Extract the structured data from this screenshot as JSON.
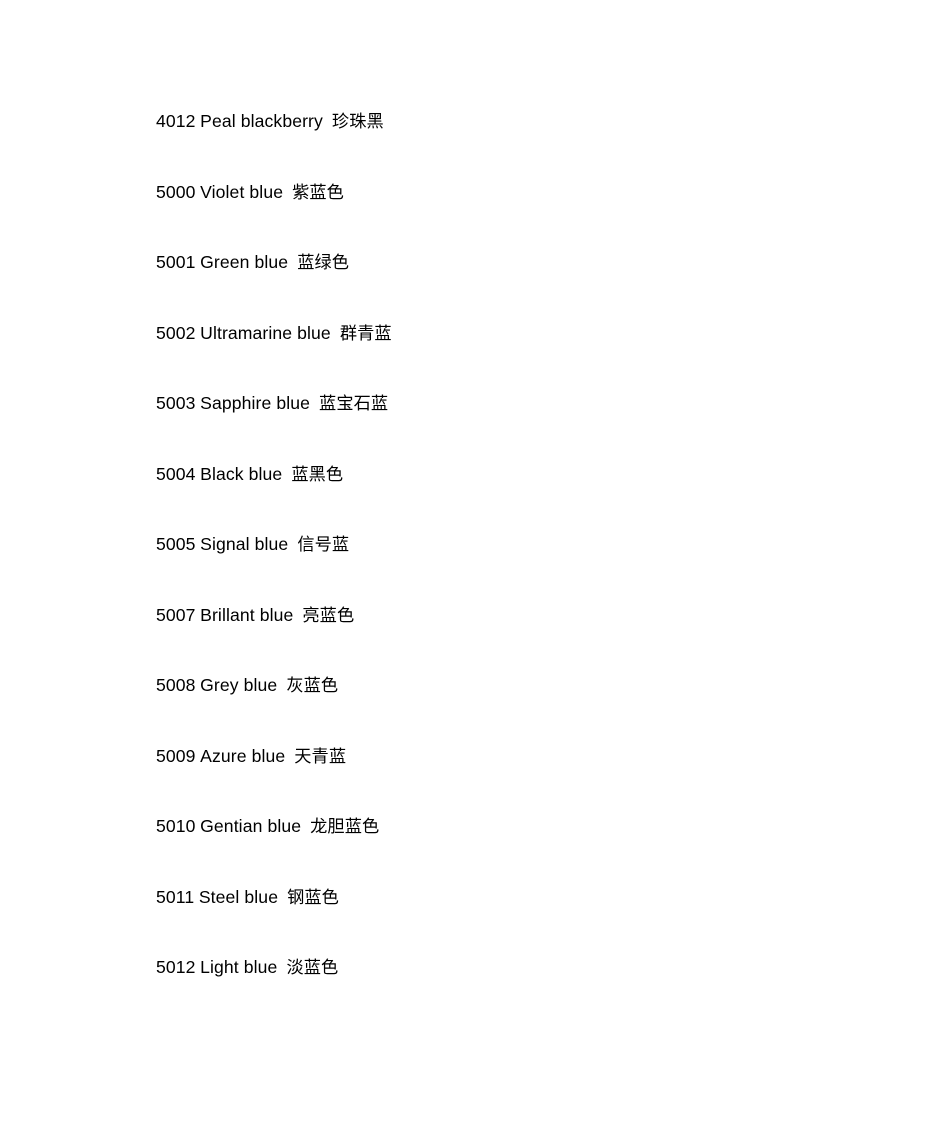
{
  "document": {
    "background_color": "#ffffff",
    "text_color": "#000000",
    "entries": [
      {
        "code": "4012",
        "name_en": "Peal blackberry",
        "name_zh": "珍珠黑"
      },
      {
        "code": "5000",
        "name_en": "Violet blue",
        "name_zh": "紫蓝色"
      },
      {
        "code": "5001",
        "name_en": "Green blue",
        "name_zh": "蓝绿色"
      },
      {
        "code": "5002",
        "name_en": "Ultramarine blue",
        "name_zh": "群青蓝"
      },
      {
        "code": "5003",
        "name_en": "Sapphire blue",
        "name_zh": "蓝宝石蓝"
      },
      {
        "code": "5004",
        "name_en": "Black blue",
        "name_zh": "蓝黑色"
      },
      {
        "code": "5005",
        "name_en": "Signal blue",
        "name_zh": "信号蓝"
      },
      {
        "code": "5007",
        "name_en": "Brillant blue",
        "name_zh": "亮蓝色"
      },
      {
        "code": "5008",
        "name_en": "Grey blue",
        "name_zh": "灰蓝色"
      },
      {
        "code": "5009",
        "name_en": "Azure blue",
        "name_zh": "天青蓝"
      },
      {
        "code": "5010",
        "name_en": "Gentian blue",
        "name_zh": "龙胆蓝色"
      },
      {
        "code": "5011",
        "name_en": "Steel blue",
        "name_zh": "钢蓝色"
      },
      {
        "code": "5012",
        "name_en": "Light blue",
        "name_zh": "淡蓝色"
      }
    ]
  }
}
